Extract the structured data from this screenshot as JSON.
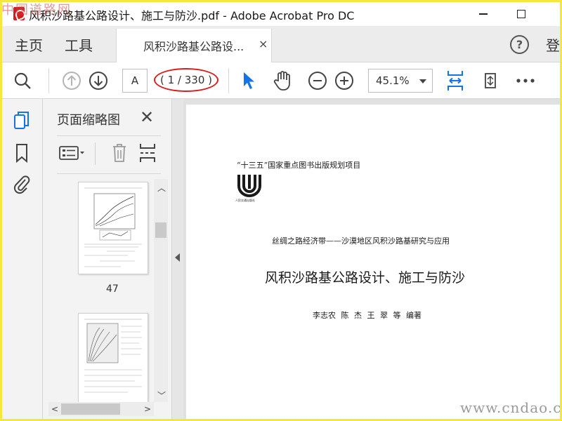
{
  "window": {
    "title": "风积沙路基公路设计、施工与防沙.pdf - Adobe Acrobat Pro DC"
  },
  "nav": {
    "home": "主页",
    "tools": "工具",
    "doc_tab": "风积沙路基公路设...",
    "close_glyph": "×",
    "help_glyph": "?",
    "login": "登"
  },
  "toolbar": {
    "page_input": "A",
    "page_count": "( 1 / 330 )",
    "zoom": "45.1%"
  },
  "panel": {
    "title": "页面缩略图",
    "close_glyph": "✕",
    "thumbnails": [
      {
        "label": "47"
      },
      {
        "label": ""
      }
    ]
  },
  "document": {
    "project_line": "“十三五”国家重点图书出版规划项目",
    "series_line": "丝绸之路经济带——沙漠地区风积沙路基研究与应用",
    "book_title": "风积沙路基公路设计、施工与防沙",
    "authors": "李志农  陈  杰  王  翠  等  编著",
    "logo_caption": "人民交通出版社"
  },
  "watermarks": {
    "top_left": "中国道路网",
    "bottom_right": "www.cndao.com"
  },
  "colors": {
    "frame": "#f5e83a",
    "annotation_oval": "#d61f1f",
    "accent_blue": "#1473e6"
  }
}
